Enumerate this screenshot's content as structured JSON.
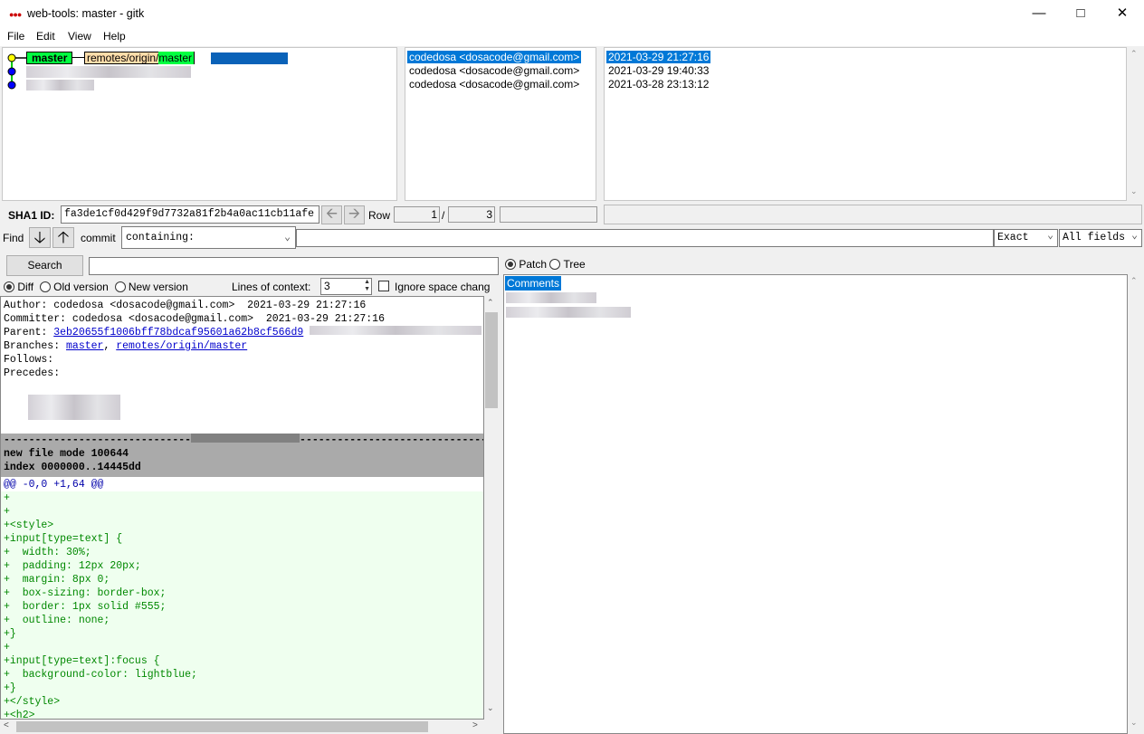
{
  "window": {
    "title": "web-tools: master - gitk",
    "icon": "gitk-icon"
  },
  "menu": [
    "File",
    "Edit",
    "View",
    "Help"
  ],
  "graph": {
    "refs": {
      "local": "master",
      "remote_prefix": "remotes/origin/",
      "remote_branch": "master"
    },
    "colors": {
      "head": "#ffff00",
      "commit": "#0000ff",
      "line": "#00cc00",
      "branch_tag": "#00ff40",
      "remote_tag": "#ffddaa"
    }
  },
  "authors": [
    "codedosa <dosacode@gmail.com>",
    "codedosa <dosacode@gmail.com>",
    "codedosa <dosacode@gmail.com>"
  ],
  "dates": [
    "2021-03-29 21:27:16",
    "2021-03-29 19:40:33",
    "2021-03-28 23:13:12"
  ],
  "sha": {
    "label": "SHA1 ID:",
    "value": "fa3de1cf0d429f9d7732a81f2b4a0ac11cb11afe",
    "row_label": "Row",
    "row": "1",
    "slash": "/",
    "total": "3"
  },
  "find": {
    "label": "Find",
    "commit_label": "commit",
    "mode": "containing:",
    "match": "Exact",
    "fields": "All fields",
    "value": ""
  },
  "search": {
    "button": "Search",
    "value": ""
  },
  "diffopts": {
    "diff": "Diff",
    "old": "Old version",
    "new": "New version",
    "context_label": "Lines of context:",
    "context": "3",
    "ignore": "Ignore space chang"
  },
  "patchtree": {
    "patch": "Patch",
    "tree": "Tree",
    "comments": "Comments"
  },
  "details": {
    "author": "Author: codedosa <dosacode@gmail.com>  2021-03-29 21:27:16",
    "committer": "Committer: codedosa <dosacode@gmail.com>  2021-03-29 21:27:16",
    "parent_label": "Parent: ",
    "parent": "3eb20655f1006bff78bdcaf95601a62b8cf566d9",
    "branches_label": "Branches: ",
    "branch1": "master",
    "sep": ", ",
    "branch2": "remotes/origin/master",
    "follows": "Follows:",
    "precedes": "Precedes:",
    "file_mode": "new file mode 100644",
    "index": "index 0000000..14445dd",
    "hunk": "@@ -0,0 +1,64 @@",
    "added": [
      "+",
      "+",
      "+<style>",
      "+input[type=text] {",
      "+  width: 30%;",
      "+  padding: 12px 20px;",
      "+  margin: 8px 0;",
      "+  box-sizing: border-box;",
      "+  border: 1px solid #555;",
      "+  outline: none;",
      "+}",
      "+",
      "+input[type=text]:focus {",
      "+  background-color: lightblue;",
      "+}",
      "+</style>",
      "+<h2>"
    ]
  }
}
